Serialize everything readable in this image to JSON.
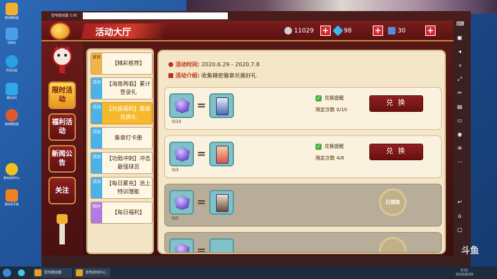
{
  "desktop": {
    "icons": [
      {
        "label": "雷电模拟器",
        "color": "#f0b030"
      },
      {
        "label": "回收站",
        "color": "#4aa0e8"
      },
      {
        "label": "阿里云盘",
        "color": "#2aa0e0"
      },
      {
        "label": "腾讯QQ",
        "color": "#30a8e8"
      },
      {
        "label": "夜神模拟器",
        "color": "#e05a30"
      },
      {
        "label": "雷电游戏中心",
        "color": "#f0c020"
      },
      {
        "label": "雷电多开器",
        "color": "#f08020"
      }
    ]
  },
  "emulator": {
    "title": "雷电模拟器 3.95"
  },
  "game": {
    "header": {
      "title": "活动大厅",
      "coins": "11029",
      "diamonds": "98",
      "tickets": "30"
    },
    "left_nav": [
      {
        "label": "限时活动",
        "active": true
      },
      {
        "label": "福利活动",
        "active": false
      },
      {
        "label": "新闻公告",
        "active": false
      },
      {
        "label": "关注",
        "active": false
      }
    ],
    "sub_nav": [
      {
        "tag": "推荐",
        "tag_color": "orange",
        "label": "【精彩推荐】",
        "active": false
      },
      {
        "tag": "活动",
        "tag_color": "blue",
        "label": "【海南再临】累计登录礼",
        "active": false
      },
      {
        "tag": "活动",
        "tag_color": "blue",
        "label": "【兑换福利】集章兑换礼",
        "active": true
      },
      {
        "tag": "活动",
        "tag_color": "blue",
        "label": "集章打卡册",
        "active": false
      },
      {
        "tag": "活动",
        "tag_color": "blue",
        "label": "【功勋冲刺】冲击最强球员",
        "active": false
      },
      {
        "tag": "活动",
        "tag_color": "blue",
        "label": "【每日累充】池上特训潜能",
        "active": false
      },
      {
        "tag": "限时",
        "tag_color": "purple",
        "label": "【每日福利】",
        "active": false
      }
    ],
    "panel": {
      "time_label": "活动时间:",
      "time_value": "2020.6.29 - 2020.7.8",
      "intro_label": "活动介绍:",
      "intro_value": "收集精密徽章兑换好礼",
      "rows": [
        {
          "count": "0/10",
          "remind": "兑换提醒",
          "limit": "限定次数 0/10",
          "button": "兑 换",
          "claimed": false
        },
        {
          "count": "0/3",
          "remind": "兑换提醒",
          "limit": "限定次数 4/8",
          "button": "兑 换",
          "claimed": false
        },
        {
          "count": "0/5",
          "stamp": "已领取",
          "claimed": true
        },
        {
          "count": "",
          "claimed": true
        }
      ]
    }
  },
  "taskbar": {
    "items": [
      "雷电模拟器",
      "雷电游戏中心"
    ],
    "time": "9:51",
    "date": "2020/6/30"
  },
  "watermark": "斗鱼"
}
